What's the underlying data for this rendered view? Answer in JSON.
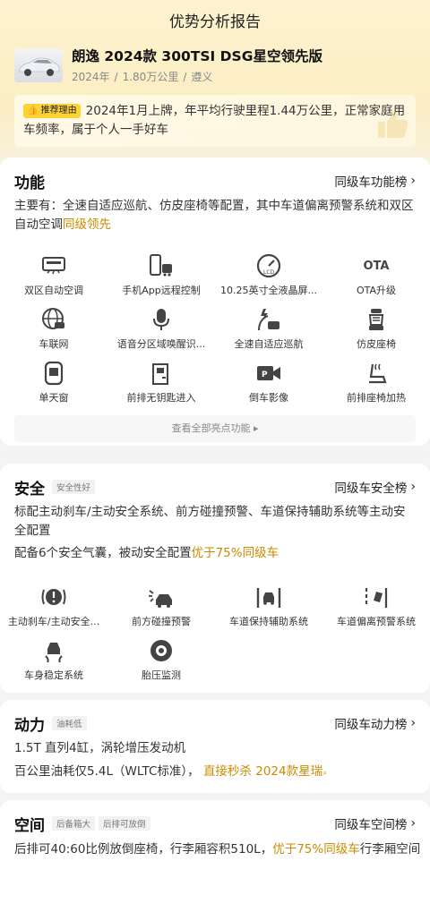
{
  "header": {
    "title": "优势分析报告"
  },
  "car": {
    "name": "朗逸 2024款 300TSI DSG星空领先版",
    "year": "2024年",
    "mileage": "1.80万公里",
    "city": "遵义"
  },
  "reason": {
    "badge": "推荐理由",
    "text": "2024年1月上牌，年平均行驶里程1.44万公里，正常家庭用车频率，属于个人一手好车"
  },
  "function_section": {
    "title": "功能",
    "rank_link": "同级车功能榜",
    "desc_main": "主要有：全速自适应巡航、仿皮座椅等配置，其中车道偏离预警系统和双区自动空调",
    "desc_highlight": "同级领先",
    "features": [
      {
        "label": "双区自动空调",
        "icon": "ac-icon"
      },
      {
        "label": "手机App远程控制",
        "icon": "phone-car-icon"
      },
      {
        "label": "10.25英寸全液晶屏...",
        "icon": "lcd-gauge-icon"
      },
      {
        "label": "OTA升级",
        "icon": "ota-icon",
        "icon_text": "OTA"
      },
      {
        "label": "车联网",
        "icon": "globe-car-icon"
      },
      {
        "label": "语音分区域唤醒识...",
        "icon": "microphone-icon"
      },
      {
        "label": "全速自适应巡航",
        "icon": "cruise-icon"
      },
      {
        "label": "仿皮座椅",
        "icon": "seat-icon"
      },
      {
        "label": "单天窗",
        "icon": "sunroof-icon"
      },
      {
        "label": "前排无钥匙进入",
        "icon": "keyless-door-icon"
      },
      {
        "label": "倒车影像",
        "icon": "reverse-camera-icon"
      },
      {
        "label": "前排座椅加热",
        "icon": "seat-heat-icon"
      }
    ],
    "more_button": "查看全部亮点功能 ▸"
  },
  "safety_section": {
    "title": "安全",
    "tag": "安全性好",
    "rank_link": "同级车安全榜",
    "desc1": "标配主动刹车/主动安全系统、前方碰撞预警、车道保持辅助系统等主动安全配置",
    "desc2_main": "配备6个安全气囊，被动安全配置",
    "desc2_highlight": "优于75%同级车",
    "features": [
      {
        "label": "主动刹车/主动安全...",
        "icon": "brake-icon"
      },
      {
        "label": "前方碰撞预警",
        "icon": "collision-warning-icon"
      },
      {
        "label": "车道保持辅助系统",
        "icon": "lane-keep-icon"
      },
      {
        "label": "车道偏离预警系统",
        "icon": "lane-departure-icon"
      },
      {
        "label": "车身稳定系统",
        "icon": "stability-icon"
      },
      {
        "label": "胎压监测",
        "icon": "tire-pressure-icon"
      }
    ]
  },
  "power_section": {
    "title": "动力",
    "tag": "油耗低",
    "rank_link": "同级车动力榜",
    "desc1": "1.5T 直列4缸，涡轮增压发动机",
    "desc2_main": "百公里油耗仅5.4L（WLTC标准），",
    "desc2_highlight": "直接秒杀 2024款星瑞",
    "desc2_icon": "search-icon"
  },
  "space_section": {
    "title": "空间",
    "tags": [
      "后备箱大",
      "后排可放倒"
    ],
    "rank_link": "同级车空间榜",
    "desc_main": "后排可40:60比例放倒座椅，行李厢容积510L，",
    "desc_highlight": "优于75%同级车",
    "desc_tail": "行李厢空间"
  },
  "colors": {
    "accent": "#c98b00",
    "badge": "#fdd236",
    "header_bg": "#fbeec4"
  }
}
